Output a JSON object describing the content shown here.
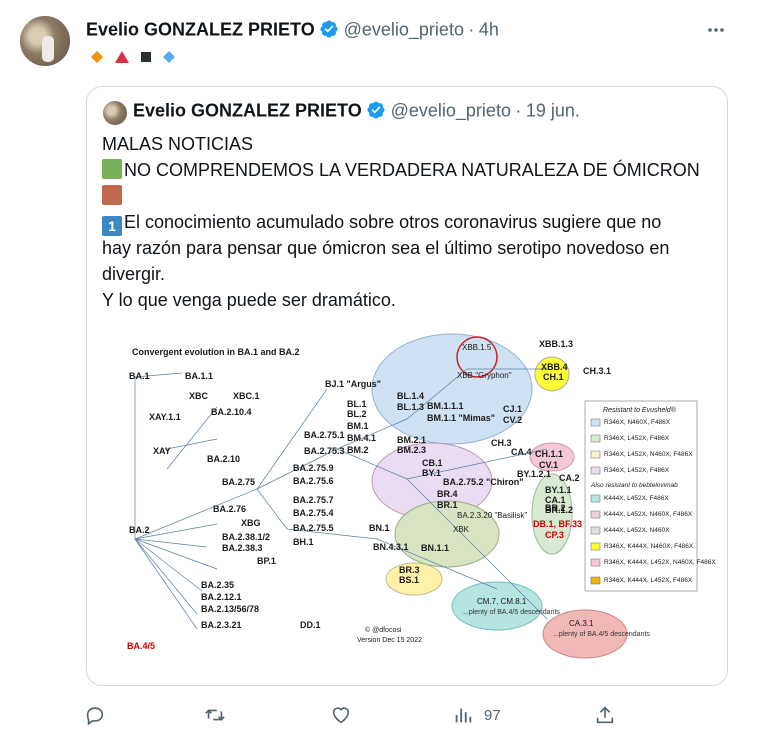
{
  "tweet": {
    "author_name": "Evelio GONZALEZ PRIETO",
    "author_handle": "@evelio_prieto",
    "separator": "·",
    "time": "4h",
    "more_icon": "more-dots-icon",
    "emoji_symbols": [
      "orange-diamond",
      "red-triangle",
      "black-square",
      "blue-diamond"
    ]
  },
  "quote": {
    "author_name": "Evelio GONZALEZ PRIETO",
    "author_handle": "@evelio_prieto",
    "separator": "·",
    "date": "19 jun.",
    "lines": [
      "MALAS NOTICIAS",
      "NO COMPRENDEMOS LA VERDADERA NATURALEZA DE ÓMICRON",
      "El conocimiento acumulado sobre otros coronavirus sugiere que no",
      "hay razón para pensar que ómicron sea el último serotipo novedoso en",
      "divergir.",
      "Y lo que venga puede ser dramático."
    ],
    "keycap_digit": "1"
  },
  "figure": {
    "title": "Convergent evolution in BA.1 and BA.2",
    "credit": "© @dfocosi",
    "version": "Version Dec 15 2022",
    "lineage_labels": [
      "BA.1",
      "BA.1.1",
      "XBC",
      "XBC.1",
      "XAY.1.1",
      "XAY",
      "BA.2.10.4",
      "BA.2.10",
      "BJ.1 \"Argus\"",
      "BL.1",
      "BL.2",
      "BL.1.4",
      "BL.1.3",
      "BA.2.75.1",
      "BA.2.75.3",
      "BM.1",
      "BM.4.1",
      "BM.2",
      "BM.1.1.1",
      "BM.1.1 \"Mimas\"",
      "CJ.1",
      "CV.2",
      "CH.3",
      "CA.4",
      "BM.2.1",
      "BM.2.3",
      "CB.1",
      "BY.1",
      "BA.2.75",
      "BA.2.75.9",
      "BA.2.75.6",
      "BA.2.75.2 \"Chiron\"",
      "BA.2.76",
      "XBG",
      "BA.2.75.7",
      "BA.2.75.4",
      "BA.2.75.5",
      "BH.1",
      "BN.1",
      "BR.4",
      "BR.1",
      "BR.2",
      "BA.2.3.20 \"Basilisk\"",
      "BN.4.3.1",
      "BN.1.1",
      "XBK",
      "BA.2",
      "BA.2.38.1/2",
      "BA.2.38.3",
      "BP.1",
      "BA.2.35",
      "BA.2.12.1",
      "BA.2.13/56/78",
      "BA.2.3.21",
      "DD.1",
      "BR.3",
      "BS.1",
      "XBB.1.5",
      "XBB \"Gryphon\"",
      "XBB.1.3",
      "XBB.4",
      "CH.1",
      "CH.3.1",
      "CH.1.1",
      "CV.1",
      "BY.1.2.1",
      "CA.2",
      "BY.1.1",
      "CA.1",
      "BR.1.2",
      "DB.1, BF.33",
      "CP.3",
      "CM.7, CM.8.1",
      "...plenty of BA.4/5 descendants",
      "CA.3.1",
      "...plenty of BA.4/5 descendants",
      "BA.4/5"
    ],
    "legend_title": "Resistant to Evusheld®",
    "legend_items": [
      {
        "label": "R346X, N460X, F486X",
        "color": "#cfe2f3"
      },
      {
        "label": "R346X, L452X, F486X",
        "color": "#d9ead3"
      },
      {
        "label": "R346X, L452X, N460X, F486X",
        "color": "#fff2cc"
      },
      {
        "label": "R346X, L452X, F486X",
        "color": "#eadcf2"
      }
    ],
    "legend_title2": "Also resistant to bebtelovimab",
    "legend_items2": [
      {
        "label": "K444X, L452X, F486X",
        "color": "#b4e5e1"
      },
      {
        "label": "K444X, L452X, N460X, F486X",
        "color": "#ead1dc"
      },
      {
        "label": "K444X, L452X, N460X",
        "color": "#e0e0e0"
      },
      {
        "label": "R346X, K444X, N460X, F486X",
        "color": "#ffff33"
      },
      {
        "label": "R346X, K444X, L452X, N460X, F486X",
        "color": "#f4c7d9"
      },
      {
        "label": "R346X, K444X, L452X, F486X",
        "color": "#f0b400"
      }
    ]
  },
  "actions": {
    "reply_icon": "reply-icon",
    "retweet_icon": "retweet-icon",
    "like_icon": "heart-icon",
    "views_icon": "views-icon",
    "views_count": "97",
    "share_icon": "share-icon"
  }
}
